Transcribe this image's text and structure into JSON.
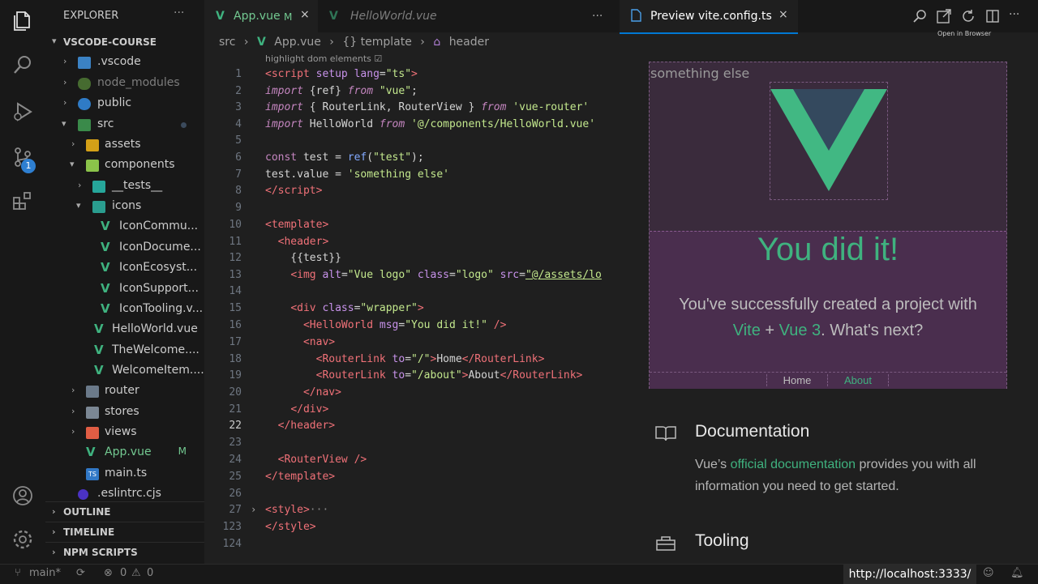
{
  "sidebar": {
    "title": "EXPLORER",
    "more": "···",
    "root": "VSCODE-COURSE",
    "items": [
      {
        "label": ".vscode",
        "mod": ""
      },
      {
        "label": "node_modules",
        "mod": ""
      },
      {
        "label": "public",
        "mod": ""
      },
      {
        "label": "src",
        "mod": ""
      },
      {
        "label": "assets",
        "mod": ""
      },
      {
        "label": "components",
        "mod": ""
      },
      {
        "label": "__tests__",
        "mod": ""
      },
      {
        "label": "icons",
        "mod": ""
      },
      {
        "label": "IconCommu...",
        "mod": ""
      },
      {
        "label": "IconDocume...",
        "mod": ""
      },
      {
        "label": "IconEcosyst...",
        "mod": ""
      },
      {
        "label": "IconSupport...",
        "mod": ""
      },
      {
        "label": "IconTooling.v...",
        "mod": ""
      },
      {
        "label": "HelloWorld.vue",
        "mod": ""
      },
      {
        "label": "TheWelcome....",
        "mod": ""
      },
      {
        "label": "WelcomeItem....",
        "mod": ""
      },
      {
        "label": "router",
        "mod": ""
      },
      {
        "label": "stores",
        "mod": ""
      },
      {
        "label": "views",
        "mod": ""
      },
      {
        "label": "App.vue",
        "mod": "M"
      },
      {
        "label": "main.ts",
        "mod": ""
      },
      {
        "label": ".eslintrc.cjs",
        "mod": ""
      }
    ],
    "sections": [
      "OUTLINE",
      "TIMELINE",
      "NPM SCRIPTS"
    ]
  },
  "activity": {
    "badge": "1"
  },
  "editor": {
    "tabs": [
      {
        "label": "App.vue",
        "mod": "M",
        "close": "×"
      },
      {
        "label": "HelloWorld.vue"
      }
    ],
    "tabs_more": "···",
    "breadcrumb": [
      "src",
      "App.vue",
      "{} template",
      "header"
    ],
    "breadcrumb_sep": "›",
    "hint": "highlight dom elements ☑",
    "line_numbers": [
      "1",
      "2",
      "3",
      "4",
      "5",
      "6",
      "7",
      "8",
      "9",
      "10",
      "11",
      "12",
      "13",
      "14",
      "15",
      "16",
      "17",
      "18",
      "19",
      "20",
      "21",
      "22",
      "23",
      "24",
      "25",
      "26",
      "27",
      "123",
      "124"
    ],
    "current_line": "22"
  },
  "preview": {
    "tab_label": "Preview vite.config.ts",
    "tab_close": "×",
    "tooltip": "Open in Browser",
    "something_else": "something else",
    "hero_title": "You did it!",
    "hero_sub_1": "You've successfully created a project with",
    "vite": "Vite",
    "plus": " + ",
    "vue3": "Vue 3",
    "whats_next": ". What's next?",
    "nav_home": "Home",
    "nav_about": "About",
    "doc_title": "Documentation",
    "doc_body_1": "Vue’s ",
    "doc_link": "official documentation",
    "doc_body_2": " provides you with all information you need to get started.",
    "tooling_title": "Tooling"
  },
  "status": {
    "branch": "main*",
    "errors": "0",
    "warnings": "0",
    "url": "http://localhost:3333/"
  },
  "colors": {
    "accent": "#0078d4",
    "vue_green": "#3fb27f",
    "modified": "#73c991"
  }
}
